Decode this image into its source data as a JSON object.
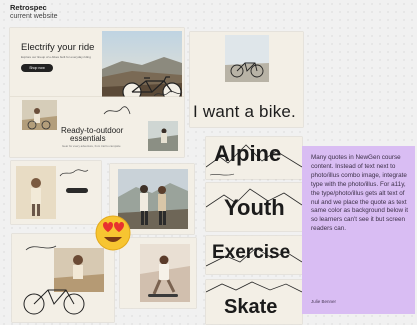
{
  "header": {
    "title": "Retrospec",
    "subtitle": "current website"
  },
  "hero": {
    "headline": "Electrify your ride",
    "blurb": "Explore our lineup of e-bikes built for everyday riding",
    "button_label": "Shop now"
  },
  "outdoor": {
    "headline_line1": "Ready-to-outdoor",
    "headline_line2": "essentials",
    "blurb": "Gear for every adventure, from trail to campsite"
  },
  "want_card": {
    "text": "I want a bike."
  },
  "word_cards": [
    "Alpine",
    "Youth",
    "Exercise",
    "Skate"
  ],
  "annotation": {
    "body": "Many quotes in NewGen course content.  Instead of text next to photo/illus combo image, integrate type with the photo/illus. For a11y, the type/photo/illus gets alt text of nul and we place the quote as text same color as background below it so learners can't see it but screen readers can.",
    "author": "Julie Benner"
  },
  "colors": {
    "card_bg": "#f3efe6",
    "note_bg": "#d9bdf3",
    "ink": "#1b1b1b"
  }
}
